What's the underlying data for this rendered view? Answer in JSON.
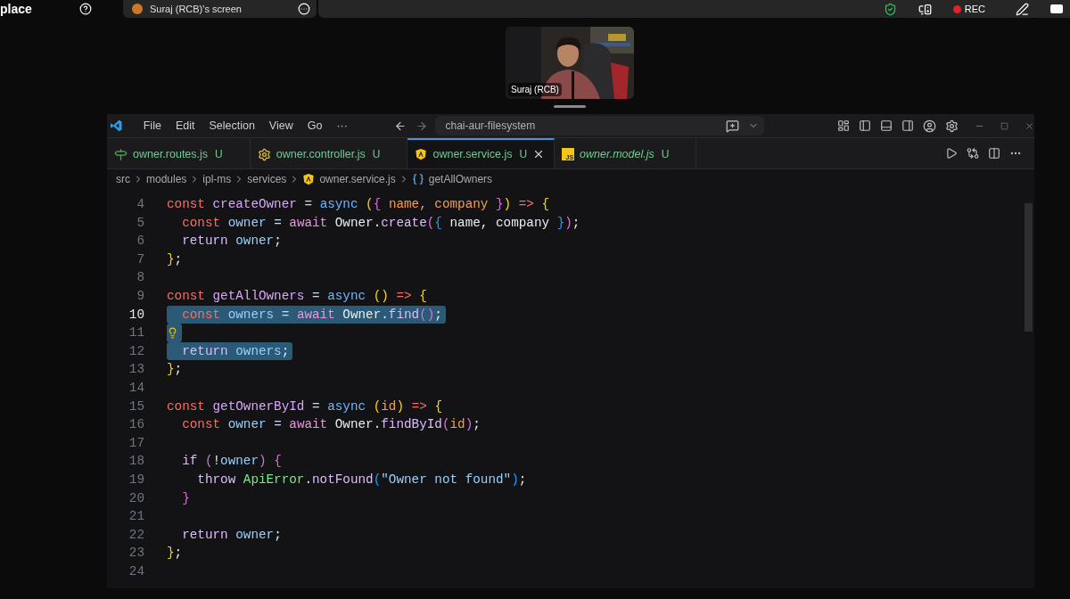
{
  "meeting_bar": {
    "title_fragment": "place",
    "shared_tab": {
      "label": "Suraj (RCB)'s screen"
    },
    "recording": {
      "label": "REC"
    }
  },
  "video_tile": {
    "name": "Suraj (RCB)",
    "kind": "picture"
  },
  "editor_window": {
    "menu": [
      "File",
      "Edit",
      "Selection",
      "View",
      "Go",
      "···"
    ],
    "search": {
      "value": "chai-aur-filesystem"
    },
    "tabs": [
      {
        "label": "owner.routes.js",
        "badge": "U",
        "selected": false,
        "preview": false,
        "kind": "routes"
      },
      {
        "label": "owner.controller.js",
        "badge": "U",
        "selected": false,
        "preview": false,
        "kind": "controller"
      },
      {
        "label": "owner.service.js",
        "badge": "U",
        "selected": true,
        "preview": false,
        "kind": "service"
      },
      {
        "label": "owner.model.js",
        "badge": "U",
        "selected": false,
        "preview": true,
        "kind": "js",
        "icon_label": "JS"
      }
    ],
    "breadcrumbs": [
      {
        "label": "src",
        "kind": "folder"
      },
      {
        "label": "modules",
        "kind": "folder"
      },
      {
        "label": "ipl-ms",
        "kind": "folder"
      },
      {
        "label": "services",
        "kind": "folder"
      },
      {
        "label": "owner.service.js",
        "kind": "service"
      },
      {
        "label": "getAllOwners",
        "kind": "symbol"
      }
    ],
    "lines": [
      {
        "number": "4",
        "current": false,
        "selected": false,
        "hint": false,
        "tokens": [
          {
            "text": "const ",
            "kind": "kw"
          },
          {
            "text": "createOwner ",
            "kind": "fn"
          },
          {
            "text": "= ",
            "kind": "op"
          },
          {
            "text": "async ",
            "kind": "st"
          },
          {
            "text": "(",
            "kind": "b1"
          },
          {
            "text": "{ ",
            "kind": "b2"
          },
          {
            "text": "name, ",
            "kind": "param"
          },
          {
            "text": "company ",
            "kind": "param"
          },
          {
            "text": "}",
            "kind": "b2"
          },
          {
            "text": ") ",
            "kind": "b1"
          },
          {
            "text": "=> ",
            "kind": "arrow"
          },
          {
            "text": "{",
            "kind": "b1"
          }
        ]
      },
      {
        "number": "5",
        "current": false,
        "selected": false,
        "hint": false,
        "tokens": [
          {
            "text": "  const ",
            "kind": "kw"
          },
          {
            "text": "owner ",
            "kind": "var"
          },
          {
            "text": "= ",
            "kind": "op"
          },
          {
            "text": "await ",
            "kind": "aw"
          },
          {
            "text": "Owner.",
            "kind": "p"
          },
          {
            "text": "create",
            "kind": "method"
          },
          {
            "text": "(",
            "kind": "b2"
          },
          {
            "text": "{ ",
            "kind": "b3"
          },
          {
            "text": "name, company ",
            "kind": "p"
          },
          {
            "text": "}",
            "kind": "b3"
          },
          {
            "text": ")",
            "kind": "b2"
          },
          {
            "text": ";",
            "kind": "p"
          }
        ]
      },
      {
        "number": "6",
        "current": false,
        "selected": false,
        "hint": false,
        "tokens": [
          {
            "text": "  return ",
            "kind": "ctrl"
          },
          {
            "text": "owner",
            "kind": "var"
          },
          {
            "text": ";",
            "kind": "p"
          }
        ]
      },
      {
        "number": "7",
        "current": false,
        "selected": false,
        "hint": false,
        "tokens": [
          {
            "text": "}",
            "kind": "b1"
          },
          {
            "text": ";",
            "kind": "p"
          }
        ]
      },
      {
        "number": "8",
        "current": false,
        "selected": false,
        "hint": false
      },
      {
        "number": "9",
        "current": false,
        "selected": false,
        "hint": false,
        "tokens": [
          {
            "text": "const ",
            "kind": "kw"
          },
          {
            "text": "getAllOwners ",
            "kind": "fn"
          },
          {
            "text": "= ",
            "kind": "op"
          },
          {
            "text": "async ",
            "kind": "st"
          },
          {
            "text": "() ",
            "kind": "b1"
          },
          {
            "text": "=> ",
            "kind": "arrow"
          },
          {
            "text": "{",
            "kind": "b1"
          }
        ]
      },
      {
        "number": "10",
        "current": true,
        "selected": true,
        "hint": false,
        "tokens": [
          {
            "text": "  const ",
            "kind": "kw"
          },
          {
            "text": "owners ",
            "kind": "var"
          },
          {
            "text": "= ",
            "kind": "op"
          },
          {
            "text": "await ",
            "kind": "aw"
          },
          {
            "text": "Owner.",
            "kind": "p"
          },
          {
            "text": "find",
            "kind": "method"
          },
          {
            "text": "()",
            "kind": "b2"
          },
          {
            "text": ";",
            "kind": "p"
          }
        ]
      },
      {
        "number": "11",
        "current": false,
        "selected": true,
        "hint": true
      },
      {
        "number": "12",
        "current": false,
        "selected": true,
        "hint": false,
        "tokens": [
          {
            "text": "  return ",
            "kind": "ctrl"
          },
          {
            "text": "owners",
            "kind": "var"
          },
          {
            "text": ";",
            "kind": "p"
          }
        ]
      },
      {
        "number": "13",
        "current": false,
        "selected": false,
        "hint": false,
        "tokens": [
          {
            "text": "}",
            "kind": "b1"
          },
          {
            "text": ";",
            "kind": "p"
          }
        ]
      },
      {
        "number": "14",
        "current": false,
        "selected": false,
        "hint": false
      },
      {
        "number": "15",
        "current": false,
        "selected": false,
        "hint": false,
        "tokens": [
          {
            "text": "const ",
            "kind": "kw"
          },
          {
            "text": "getOwnerById ",
            "kind": "fn"
          },
          {
            "text": "= ",
            "kind": "op"
          },
          {
            "text": "async ",
            "kind": "st"
          },
          {
            "text": "(",
            "kind": "b1"
          },
          {
            "text": "id",
            "kind": "param"
          },
          {
            "text": ") ",
            "kind": "b1"
          },
          {
            "text": "=> ",
            "kind": "arrow"
          },
          {
            "text": "{",
            "kind": "b1"
          }
        ]
      },
      {
        "number": "16",
        "current": false,
        "selected": false,
        "hint": false,
        "tokens": [
          {
            "text": "  const ",
            "kind": "kw"
          },
          {
            "text": "owner ",
            "kind": "var"
          },
          {
            "text": "= ",
            "kind": "op"
          },
          {
            "text": "await ",
            "kind": "aw"
          },
          {
            "text": "Owner.",
            "kind": "p"
          },
          {
            "text": "findById",
            "kind": "method"
          },
          {
            "text": "(",
            "kind": "b2"
          },
          {
            "text": "id",
            "kind": "param"
          },
          {
            "text": ")",
            "kind": "b2"
          },
          {
            "text": ";",
            "kind": "p"
          }
        ]
      },
      {
        "number": "17",
        "current": false,
        "selected": false,
        "hint": false
      },
      {
        "number": "18",
        "current": false,
        "selected": false,
        "hint": false,
        "tokens": [
          {
            "text": "  if ",
            "kind": "ctrl"
          },
          {
            "text": "(",
            "kind": "b2"
          },
          {
            "text": "!",
            "kind": "p"
          },
          {
            "text": "owner",
            "kind": "var"
          },
          {
            "text": ") ",
            "kind": "b2"
          },
          {
            "text": "{",
            "kind": "b2"
          }
        ]
      },
      {
        "number": "19",
        "current": false,
        "selected": false,
        "hint": false,
        "tokens": [
          {
            "text": "    throw ",
            "kind": "ctrl"
          },
          {
            "text": "ApiError",
            "kind": "cls"
          },
          {
            "text": ".",
            "kind": "p"
          },
          {
            "text": "notFound",
            "kind": "method"
          },
          {
            "text": "(",
            "kind": "b3"
          },
          {
            "text": "\"Owner not found\"",
            "kind": "str"
          },
          {
            "text": ")",
            "kind": "b3"
          },
          {
            "text": ";",
            "kind": "p"
          }
        ]
      },
      {
        "number": "20",
        "current": false,
        "selected": false,
        "hint": false,
        "tokens": [
          {
            "text": "  }",
            "kind": "b2"
          }
        ]
      },
      {
        "number": "21",
        "current": false,
        "selected": false,
        "hint": false
      },
      {
        "number": "22",
        "current": false,
        "selected": false,
        "hint": false,
        "tokens": [
          {
            "text": "  return ",
            "kind": "ctrl"
          },
          {
            "text": "owner",
            "kind": "var"
          },
          {
            "text": ";",
            "kind": "p"
          }
        ]
      },
      {
        "number": "23",
        "current": false,
        "selected": false,
        "hint": false,
        "tokens": [
          {
            "text": "}",
            "kind": "b1"
          },
          {
            "text": ";",
            "kind": "p"
          }
        ]
      },
      {
        "number": "24",
        "current": false,
        "selected": false,
        "hint": false
      }
    ]
  }
}
